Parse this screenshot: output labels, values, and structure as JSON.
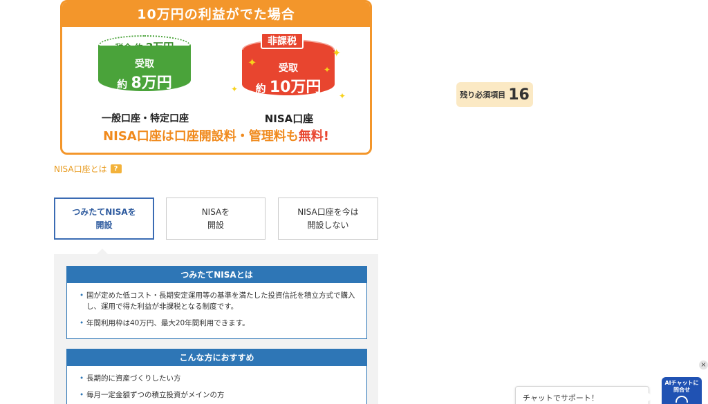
{
  "banner": {
    "title": "10万円の利益がでた場合",
    "left": {
      "top_label": "税金",
      "top_approx": "約",
      "top_amount": "2万円",
      "body_line1": "受取",
      "body_approx": "約",
      "body_amount": "8万円",
      "caption": "一般口座・特定口座"
    },
    "right": {
      "tag": "非課税",
      "body_line1": "受取",
      "body_approx": "約",
      "body_amount": "10万円",
      "caption": "NISA口座"
    },
    "footer_main": "NISA口座は口座開設料・管理料も",
    "footer_emph": "無料!"
  },
  "help_link": {
    "label": "NISA口座とは",
    "badge": "?"
  },
  "options": [
    {
      "label": "つみたてNISAを\n開設",
      "selected": true
    },
    {
      "label": "NISAを\n開設",
      "selected": false
    },
    {
      "label": "NISA口座を今は\n開設しない",
      "selected": false
    }
  ],
  "info_sections": [
    {
      "title": "つみたてNISAとは",
      "items": [
        "国が定めた低コスト・長期安定運用等の基準を満たした投資信託を積立方式で購入し、運用で得た利益が非課税となる制度です。",
        "年間利用枠は40万円、最大20年間利用できます。"
      ]
    },
    {
      "title": "こんな方におすすめ",
      "items": [
        "長期的に資産づくりしたい方",
        "毎月一定金額ずつの積立投資がメインの方"
      ]
    }
  ],
  "remaining": {
    "label": "残り必須項目",
    "count": "16"
  },
  "chat": {
    "close": "×",
    "bubble": "チャットでサポート！",
    "button_line1": "AIチャットに",
    "button_line2": "問合せ"
  },
  "colors": {
    "banner_orange": "#f3962b",
    "green_can": "#4aa33a",
    "red_can": "#e8452f",
    "accent_blue": "#2e76b6",
    "selected_blue": "#3a6bb3",
    "remain_bg": "#fbe9c4",
    "chat_blue": "#2052b3"
  }
}
